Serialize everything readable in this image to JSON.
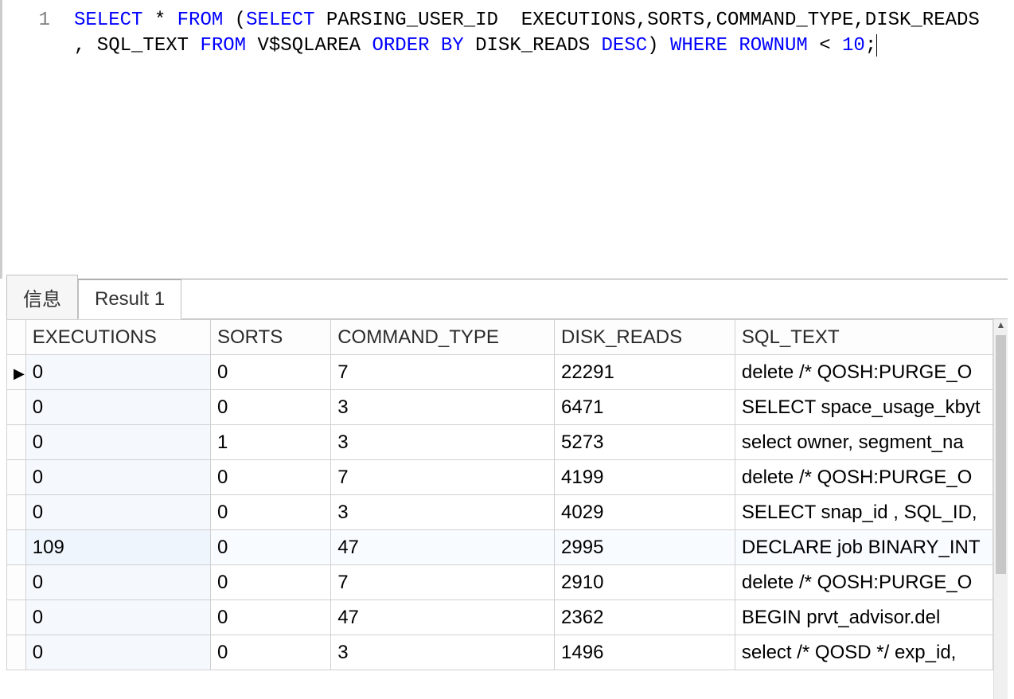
{
  "editor": {
    "line_number": "1",
    "sql_tokens": [
      {
        "t": "SELECT",
        "c": "kw-blue"
      },
      {
        "t": " * ",
        "c": "kw-text"
      },
      {
        "t": "FROM",
        "c": "kw-blue"
      },
      {
        "t": " (",
        "c": "kw-text"
      },
      {
        "t": "SELECT",
        "c": "kw-blue"
      },
      {
        "t": " PARSING_USER_ID  EXECUTIONS,SORTS,COMMAND_TYPE,DISK_READS , SQL_TEXT ",
        "c": "kw-text"
      },
      {
        "t": "FROM",
        "c": "kw-blue"
      },
      {
        "t": " V$SQLAREA ",
        "c": "kw-text"
      },
      {
        "t": "ORDER BY",
        "c": "kw-blue"
      },
      {
        "t": " DISK_READS ",
        "c": "kw-text"
      },
      {
        "t": "DESC",
        "c": "kw-blue"
      },
      {
        "t": ") ",
        "c": "kw-text"
      },
      {
        "t": "WHERE",
        "c": "kw-blue"
      },
      {
        "t": " ",
        "c": "kw-text"
      },
      {
        "t": "ROWNUM",
        "c": "kw-blue"
      },
      {
        "t": " < ",
        "c": "kw-text"
      },
      {
        "t": "10",
        "c": "kw-num"
      },
      {
        "t": ";",
        "c": "kw-text"
      }
    ]
  },
  "tabs": {
    "info_label": "信息",
    "result_label": "Result 1"
  },
  "grid": {
    "headers": {
      "executions": "EXECUTIONS",
      "sorts": "SORTS",
      "command_type": "COMMAND_TYPE",
      "disk_reads": "DISK_READS",
      "sql_text": "SQL_TEXT"
    },
    "sorted_column": "executions",
    "current_row_index": 0,
    "rows": [
      {
        "executions": "0",
        "sorts": "0",
        "command_type": "7",
        "disk_reads": "22291",
        "sql_text": "delete /* QOSH:PURGE_O"
      },
      {
        "executions": "0",
        "sorts": "0",
        "command_type": "3",
        "disk_reads": "6471",
        "sql_text": "SELECT space_usage_kbyt"
      },
      {
        "executions": "0",
        "sorts": "1",
        "command_type": "3",
        "disk_reads": "5273",
        "sql_text": "select owner, segment_na"
      },
      {
        "executions": "0",
        "sorts": "0",
        "command_type": "7",
        "disk_reads": "4199",
        "sql_text": "delete /* QOSH:PURGE_O"
      },
      {
        "executions": "0",
        "sorts": "0",
        "command_type": "3",
        "disk_reads": "4029",
        "sql_text": "SELECT snap_id , SQL_ID,"
      },
      {
        "executions": "109",
        "sorts": "0",
        "command_type": "47",
        "disk_reads": "2995",
        "sql_text": "DECLARE job BINARY_INT"
      },
      {
        "executions": "0",
        "sorts": "0",
        "command_type": "7",
        "disk_reads": "2910",
        "sql_text": "delete /* QOSH:PURGE_O"
      },
      {
        "executions": "0",
        "sorts": "0",
        "command_type": "47",
        "disk_reads": "2362",
        "sql_text": "BEGIN    prvt_advisor.del"
      },
      {
        "executions": "0",
        "sorts": "0",
        "command_type": "3",
        "disk_reads": "1496",
        "sql_text": "select /* QOSD */ exp_id,"
      }
    ]
  },
  "icons": {
    "row_pointer": "▶",
    "scroll_up": "▲"
  }
}
